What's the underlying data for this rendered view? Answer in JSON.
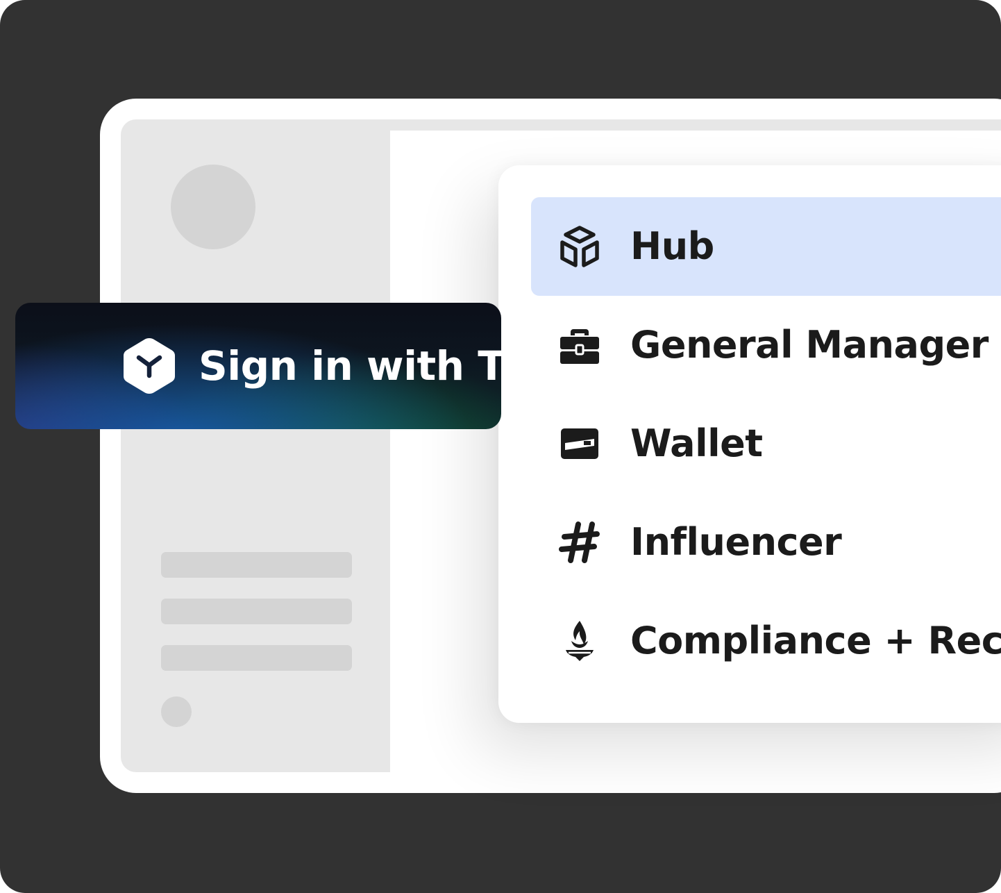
{
  "signin": {
    "label": "Sign in with Tea",
    "icon": "team-cube-logo-icon"
  },
  "menu": {
    "items": [
      {
        "label": "Hub",
        "icon": "cube-icon",
        "active": true
      },
      {
        "label": "General Manager",
        "icon": "briefcase-icon",
        "active": false
      },
      {
        "label": "Wallet",
        "icon": "credit-card-icon",
        "active": false
      },
      {
        "label": "Influencer",
        "icon": "hashtag-icon",
        "active": false
      },
      {
        "label": "Compliance + Recru",
        "icon": "torch-icon",
        "active": false
      }
    ]
  },
  "colors": {
    "frame": "#323232",
    "window": "#ffffff",
    "sidebar": "#e7e7e7",
    "skeleton": "#d4d4d4",
    "active_item": "#d8e4fc",
    "text": "#1b1b1b"
  }
}
